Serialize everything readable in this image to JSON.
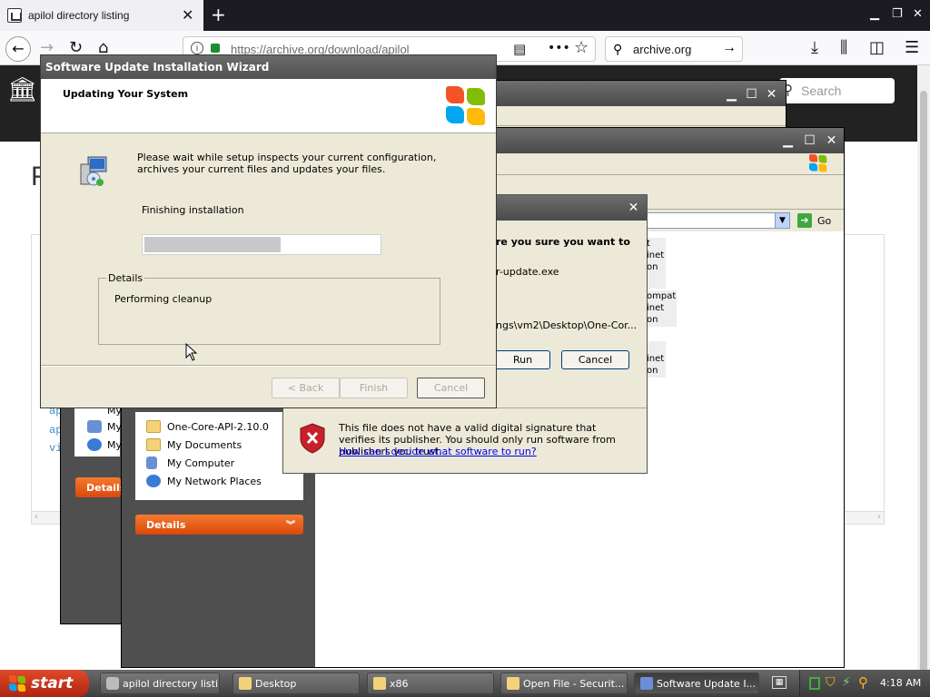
{
  "browser": {
    "tab_title": "apilol directory listing",
    "url_text": "https://archive.org/download/apilol",
    "search_text": "archive.org"
  },
  "archive_page": {
    "search_placeholder": "Search",
    "heading_partial": "F",
    "code_lines": [
      "ap",
      "ap",
      "vi"
    ]
  },
  "wizard": {
    "title": "Software Update Installation Wizard",
    "header": "Updating Your System",
    "body_text": "Please wait while setup inspects your current configuration, archives your current files and updates your files.",
    "status": "Finishing installation",
    "progress_fraction": 0.58,
    "details_label": "Details",
    "details_value": "Performing cleanup",
    "buttons": {
      "back": "< Back",
      "finish": "Finish",
      "cancel": "Cancel"
    }
  },
  "security_dialog": {
    "question_partial": "re you sure you want to",
    "file_partial": "r-update.exe",
    "path_partial": "ngs\\vm2\\Desktop\\One-Cor...",
    "run_label": "Run",
    "cancel_label": "Cancel",
    "warning_text": "This file does not have a valid digital signature that verifies its publisher.  You should only run software from publishers you trust.",
    "warning_link": "How can I decide what software to run?"
  },
  "explorer_back": {
    "go_label": "Go",
    "list_fragments": [
      "t",
      "inet",
      "on",
      "ompat",
      "inet",
      "on",
      "inet",
      "on"
    ],
    "places": [
      "One-Core-API-2.10.0",
      "My Documents",
      "My Computer",
      "My Network Places"
    ],
    "details_label": "Details",
    "places_partial": [
      "My",
      "My",
      "My"
    ],
    "details_label_partial": "Details"
  },
  "taskbar": {
    "start_label": "start",
    "tasks": [
      "apilol directory listi...",
      "Desktop",
      "x86",
      "Open File - Securit...",
      "Software Update I..."
    ],
    "clock": "4:18 AM"
  },
  "colors": {
    "xp_title_gray": "#5a5a5a",
    "details_orange": "#e8611a",
    "link_blue": "#0000ee"
  }
}
